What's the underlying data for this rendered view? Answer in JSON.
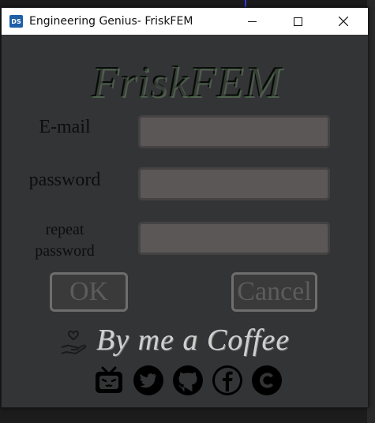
{
  "window": {
    "title": "Engineering Genius- FriskFEM",
    "app_icon_text": "DS"
  },
  "logo": {
    "text": "FriskFEM"
  },
  "form": {
    "email_label": "E-mail",
    "password_label": "password",
    "repeat_label_line1": "repeat",
    "repeat_label_line2": "password",
    "email_value": "",
    "password_value": "",
    "repeat_value": ""
  },
  "buttons": {
    "ok_label": "OK",
    "cancel_label": "Cancel"
  },
  "coffee": {
    "text": "By me a Coffee"
  },
  "social_icons": [
    "bilibili-icon",
    "twitter-icon",
    "github-icon",
    "facebook-icon",
    "c-icon"
  ],
  "colors": {
    "window_bg": "#333435",
    "field_bg": "#5b5757",
    "logo_green": "#2f6a2b"
  }
}
